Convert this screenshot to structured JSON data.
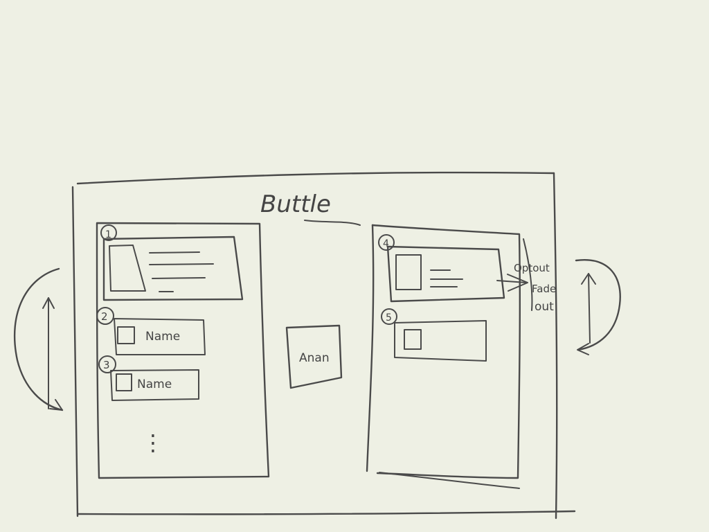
{
  "title": "Buttle",
  "left_panel": {
    "items": [
      {
        "number": "1"
      },
      {
        "number": "2",
        "label": "Name"
      },
      {
        "number": "3",
        "label": "Name"
      }
    ],
    "more": "⋮"
  },
  "center_card": {
    "label": "Anan"
  },
  "right_panel": {
    "items": [
      {
        "number": "4"
      },
      {
        "number": "5"
      }
    ]
  },
  "annotation": {
    "lines": [
      "Optout",
      "Fade",
      "out"
    ]
  }
}
